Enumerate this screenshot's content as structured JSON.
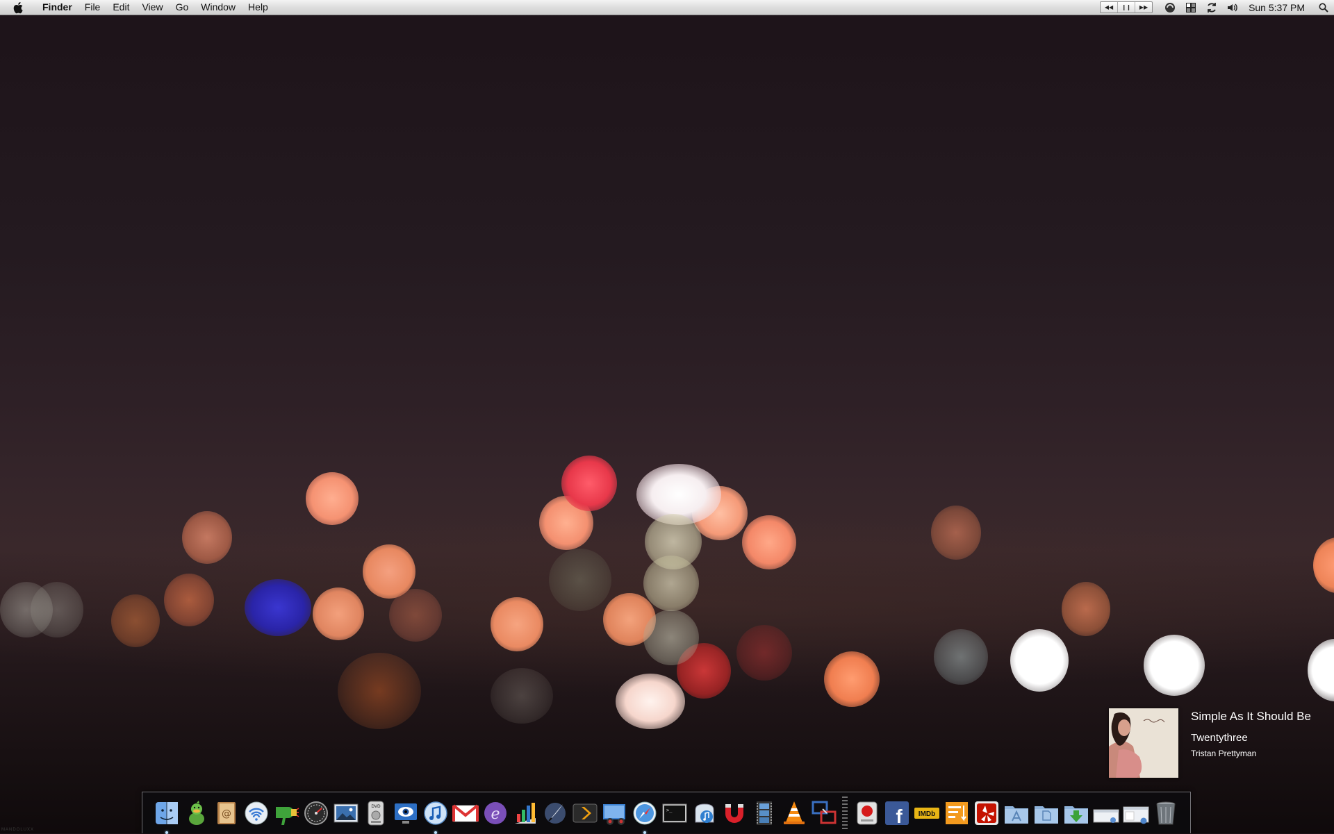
{
  "menubar": {
    "apple_icon": "apple-logo-icon",
    "app_name": "Finder",
    "menus": [
      "File",
      "Edit",
      "View",
      "Go",
      "Window",
      "Help"
    ],
    "status_icons": [
      "media-controls",
      "growl-icon",
      "spaces-icon",
      "time-machine-sync-icon",
      "volume-icon"
    ],
    "clock": "Sun 5:37 PM",
    "spotlight_icon": "spotlight-search-icon"
  },
  "now_playing": {
    "title": "Simple As It Should Be",
    "album": "Twentythree",
    "artist": "Tristan Prettyman"
  },
  "dock": {
    "items": [
      {
        "name": "finder",
        "icon": "finder-icon",
        "running": true
      },
      {
        "name": "adium",
        "icon": "adium-duck-icon",
        "running": false
      },
      {
        "name": "address-book",
        "icon": "address-book-icon",
        "running": false
      },
      {
        "name": "airport",
        "icon": "airport-wifi-icon",
        "running": false
      },
      {
        "name": "hair-dryer-app",
        "icon": "hair-dryer-icon",
        "running": false
      },
      {
        "name": "istat",
        "icon": "gauge-icon",
        "running": false
      },
      {
        "name": "preview",
        "icon": "photo-preview-icon",
        "running": false
      },
      {
        "name": "dvd-player",
        "icon": "dvd-player-icon",
        "running": false
      },
      {
        "name": "eye-app",
        "icon": "eye-monitor-icon",
        "running": false
      },
      {
        "name": "itunes",
        "icon": "itunes-icon",
        "running": true
      },
      {
        "name": "gmail",
        "icon": "gmail-envelope-icon",
        "running": false
      },
      {
        "name": "e-editor",
        "icon": "e-text-editor-icon",
        "running": false
      },
      {
        "name": "charts-app",
        "icon": "bar-chart-icon",
        "running": false
      },
      {
        "name": "quill-app",
        "icon": "quill-pen-icon",
        "running": false
      },
      {
        "name": "plex",
        "icon": "plex-chevron-icon",
        "running": false
      },
      {
        "name": "remote-desktop",
        "icon": "remote-desktop-icon",
        "running": false
      },
      {
        "name": "safari",
        "icon": "safari-compass-icon",
        "running": true
      },
      {
        "name": "terminal",
        "icon": "terminal-icon",
        "running": false
      },
      {
        "name": "music-app",
        "icon": "music-note-icon",
        "running": false
      },
      {
        "name": "magnet",
        "icon": "magnet-icon",
        "running": false
      },
      {
        "name": "film-strip",
        "icon": "film-strip-icon",
        "running": false
      },
      {
        "name": "vlc",
        "icon": "vlc-cone-icon",
        "running": false
      },
      {
        "name": "screen-sharing",
        "icon": "screen-sharing-icon",
        "running": false
      },
      {
        "name": "record-app",
        "icon": "record-button-icon",
        "running": false
      },
      {
        "name": "facebook",
        "icon": "facebook-icon",
        "running": false
      },
      {
        "name": "imdb",
        "icon": "imdb-icon",
        "running": false
      },
      {
        "name": "sort-app",
        "icon": "sort-list-icon",
        "running": false
      },
      {
        "name": "yelp",
        "icon": "yelp-icon",
        "running": false
      },
      {
        "name": "applications-folder",
        "icon": "applications-folder-icon",
        "running": false
      },
      {
        "name": "documents-folder",
        "icon": "documents-folder-icon",
        "running": false
      },
      {
        "name": "downloads-folder",
        "icon": "downloads-folder-icon",
        "running": false
      },
      {
        "name": "stack-window-1",
        "icon": "window-stack-icon",
        "running": false
      },
      {
        "name": "stack-window-2",
        "icon": "window-stack-music-icon",
        "running": false
      },
      {
        "name": "trash",
        "icon": "trash-icon",
        "running": false
      }
    ]
  },
  "watermark": "MANDOLUXX"
}
